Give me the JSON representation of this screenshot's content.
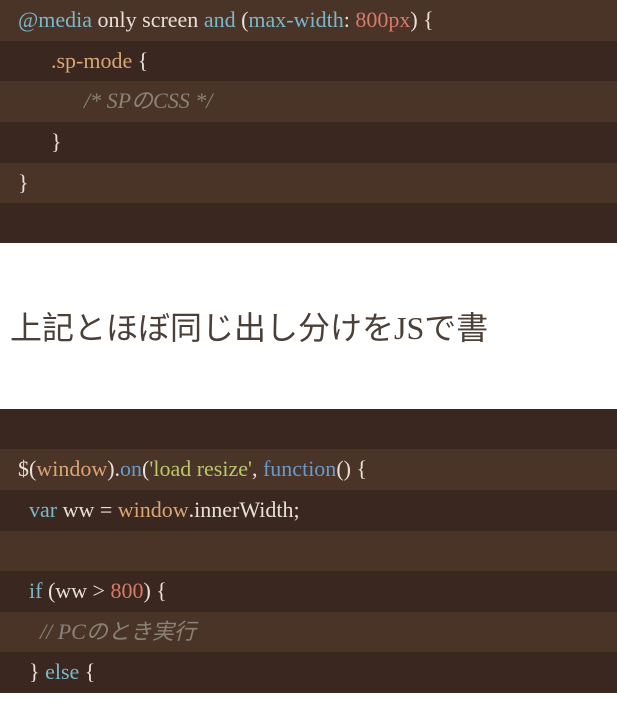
{
  "code_block_1": {
    "lines": [
      {
        "tokens": [
          {
            "cls": "tok-at",
            "text": "@media"
          },
          {
            "cls": "tok-plain",
            "text": " only screen "
          },
          {
            "cls": "tok-at",
            "text": "and"
          },
          {
            "cls": "tok-plain",
            "text": " ("
          },
          {
            "cls": "tok-at",
            "text": "max-width"
          },
          {
            "cls": "tok-plain",
            "text": ": "
          },
          {
            "cls": "tok-number",
            "text": "800px"
          },
          {
            "cls": "tok-plain",
            "text": ") { "
          }
        ]
      },
      {
        "tokens": [
          {
            "cls": "tok-plain",
            "text": "      "
          },
          {
            "cls": "tok-selector",
            "text": ".sp-mode"
          },
          {
            "cls": "tok-plain",
            "text": " {"
          }
        ]
      },
      {
        "tokens": [
          {
            "cls": "tok-plain",
            "text": "            "
          },
          {
            "cls": "tok-comment",
            "text": "/* SPのCSS */"
          }
        ]
      },
      {
        "tokens": [
          {
            "cls": "tok-plain",
            "text": "      }"
          }
        ]
      },
      {
        "tokens": [
          {
            "cls": "tok-plain",
            "text": "}"
          }
        ]
      },
      {
        "tokens": []
      }
    ]
  },
  "text_section": {
    "heading": "上記とほぼ同じ出し分けをJSで書"
  },
  "code_block_2": {
    "lines": [
      {
        "tokens": []
      },
      {
        "tokens": [
          {
            "cls": "tok-plain",
            "text": "$("
          },
          {
            "cls": "tok-var",
            "text": "window"
          },
          {
            "cls": "tok-plain",
            "text": ")."
          },
          {
            "cls": "tok-function",
            "text": "on"
          },
          {
            "cls": "tok-plain",
            "text": "("
          },
          {
            "cls": "tok-string",
            "text": "'load resize'"
          },
          {
            "cls": "tok-plain",
            "text": ", "
          },
          {
            "cls": "tok-function",
            "text": "function"
          },
          {
            "cls": "tok-plain",
            "text": "() {"
          }
        ]
      },
      {
        "tokens": [
          {
            "cls": "tok-plain",
            "text": "  "
          },
          {
            "cls": "tok-keyword",
            "text": "var"
          },
          {
            "cls": "tok-plain",
            "text": " ww = "
          },
          {
            "cls": "tok-var",
            "text": "window"
          },
          {
            "cls": "tok-plain",
            "text": ".innerWidth;"
          }
        ]
      },
      {
        "tokens": []
      },
      {
        "tokens": [
          {
            "cls": "tok-plain",
            "text": "  "
          },
          {
            "cls": "tok-keyword",
            "text": "if"
          },
          {
            "cls": "tok-plain",
            "text": " (ww > "
          },
          {
            "cls": "tok-number",
            "text": "800"
          },
          {
            "cls": "tok-plain",
            "text": ") {"
          }
        ]
      },
      {
        "tokens": [
          {
            "cls": "tok-plain",
            "text": "    "
          },
          {
            "cls": "tok-comment",
            "text": "// PCのとき実行"
          }
        ]
      },
      {
        "tokens": [
          {
            "cls": "tok-plain",
            "text": "  } "
          },
          {
            "cls": "tok-keyword",
            "text": "else"
          },
          {
            "cls": "tok-plain",
            "text": " {"
          }
        ]
      }
    ]
  }
}
